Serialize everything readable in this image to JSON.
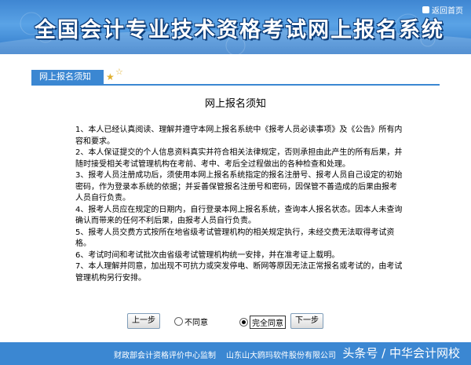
{
  "header": {
    "title": "全国会计专业技术资格考试网上报名系统",
    "home_link": "返回首页"
  },
  "tab": {
    "label": "网上报名须知"
  },
  "main": {
    "heading": "网上报名须知",
    "notes": [
      "1、本人已经认真阅读、理解并遵守本网上报名系统中《报考人员必读事项》及《公告》所有内容和要求。",
      "2、本人保证提交的个人信息资料真实并符合相关法律规定，否则承担由此产生的所有后果，并随时接受相关考试管理机构在考前、考中、考后全过程做出的各种检查和处理。",
      "3、报考人员注册成功后，须使用本网上报名系统指定的报名注册号、报考人员自己设定的初始密码，作为登录本系统的依据；并妥善保管报名注册号和密码，因保管不善造成的后果由报考人员自行负责。",
      "4、报考人员应在规定的日期内，自行登录本网上报名系统，查询本人报名状态。因本人未查询确认而带来的任何不利后果，由报考人员自行负责。",
      "5、报考人员交费方式按所在地省级考试管理机构的相关规定执行，未经交费无法取得考试资格。",
      "6、考试时间和考试批次由省级考试管理机构统一安排，并在准考证上载明。",
      "7、本人理解并同意，加出现不可抗力或突发停电、断网等原因无法正常报名或考试的，由考试管理机构另行安排。"
    ]
  },
  "controls": {
    "prev_label": "上一步",
    "disagree_label": "不同意",
    "agree_label": "完全同意",
    "next_label": "下一步",
    "selected": "agree"
  },
  "footer": {
    "supervisor": "财政部会计资格评价中心监制",
    "developer": "山东山大鸥玛软件股份有限公司",
    "watermark": "头条号 / 中华会计网校"
  },
  "colors": {
    "accent": "#3b87d2",
    "banner": "#4a95dd"
  },
  "icons": {
    "home": "home-icon",
    "stars": "star-icon"
  }
}
